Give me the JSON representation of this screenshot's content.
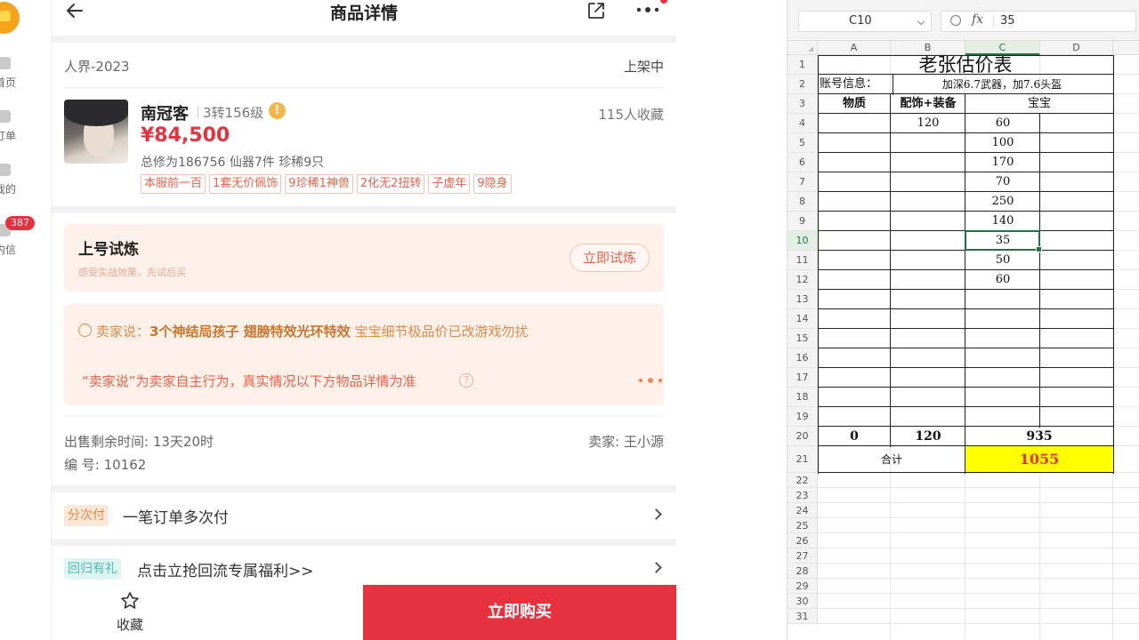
{
  "sidebar": {
    "items": [
      {
        "label": "首页",
        "icon": "home-icon"
      },
      {
        "label": "订单",
        "icon": "order-icon"
      },
      {
        "label": "我的",
        "icon": "user-icon"
      },
      {
        "label": "内信",
        "icon": "mail-icon"
      }
    ],
    "badge": "387"
  },
  "header": {
    "title": "商品详情"
  },
  "listing": {
    "server": "人界-2023",
    "status": "上架中",
    "name": "南冠客",
    "level": "3转156级",
    "favorites": "115人收藏",
    "price": "¥84,500",
    "stats": "总修为186756  仙器7件  珍稀9只",
    "tags": [
      "本服前一百",
      "1套无价佩饰",
      "9珍稀1神兽",
      "2化无2扭转",
      "子虚年",
      "9隐身"
    ]
  },
  "trial": {
    "title": "上号试炼",
    "subtitle": "感受实战效果，先试后买",
    "button": "立即试炼"
  },
  "seller_says": {
    "prefix": "卖家说：",
    "highlight": "3个神结局孩子 翅膀特效光环特效",
    "rest": " 宝宝细节极品价已改游戏勿扰",
    "disclaimer": "“卖家说”为卖家自主行为，真实情况以下方物品详情为准",
    "help": "?"
  },
  "meta": {
    "remaining": "出售剩余时间: 13天20时",
    "seller": "卖家: 王小源",
    "serial": "编 号: 10162"
  },
  "installment": {
    "pill": "分次付",
    "text": "一笔订单多次付"
  },
  "return_gift": {
    "pill": "回归有礼",
    "text": "点击立抢回流专属福利>>"
  },
  "bottom": {
    "collect": "收藏",
    "buy": "立即购买"
  },
  "spreadsheet": {
    "namebox": "C10",
    "formula_value": "35",
    "columns": [
      "A",
      "B",
      "C",
      "D"
    ],
    "rows": [
      "1",
      "2",
      "3",
      "4",
      "5",
      "6",
      "7",
      "8",
      "9",
      "10",
      "11",
      "12",
      "13",
      "14",
      "15",
      "16",
      "17",
      "18",
      "19",
      "20",
      "21",
      "22",
      "23",
      "24",
      "25",
      "26",
      "27",
      "28",
      "29",
      "30",
      "31"
    ],
    "title": "老张估价表",
    "account_label": "账号信息：",
    "account_value": "加深6.7武器，加7.6头盔",
    "headers": [
      "物质",
      "配饰+装备",
      "宝宝"
    ],
    "col_b_values": [
      "120"
    ],
    "col_c_values": [
      "60",
      "100",
      "170",
      "70",
      "250",
      "140",
      "35",
      "50",
      "60"
    ],
    "sums": [
      "0",
      "120",
      "935"
    ],
    "total_label": "合计",
    "total_value": "1055",
    "total_color": "#ffff00",
    "total_text_color": "#e8313e",
    "selected_color": "#217346"
  }
}
